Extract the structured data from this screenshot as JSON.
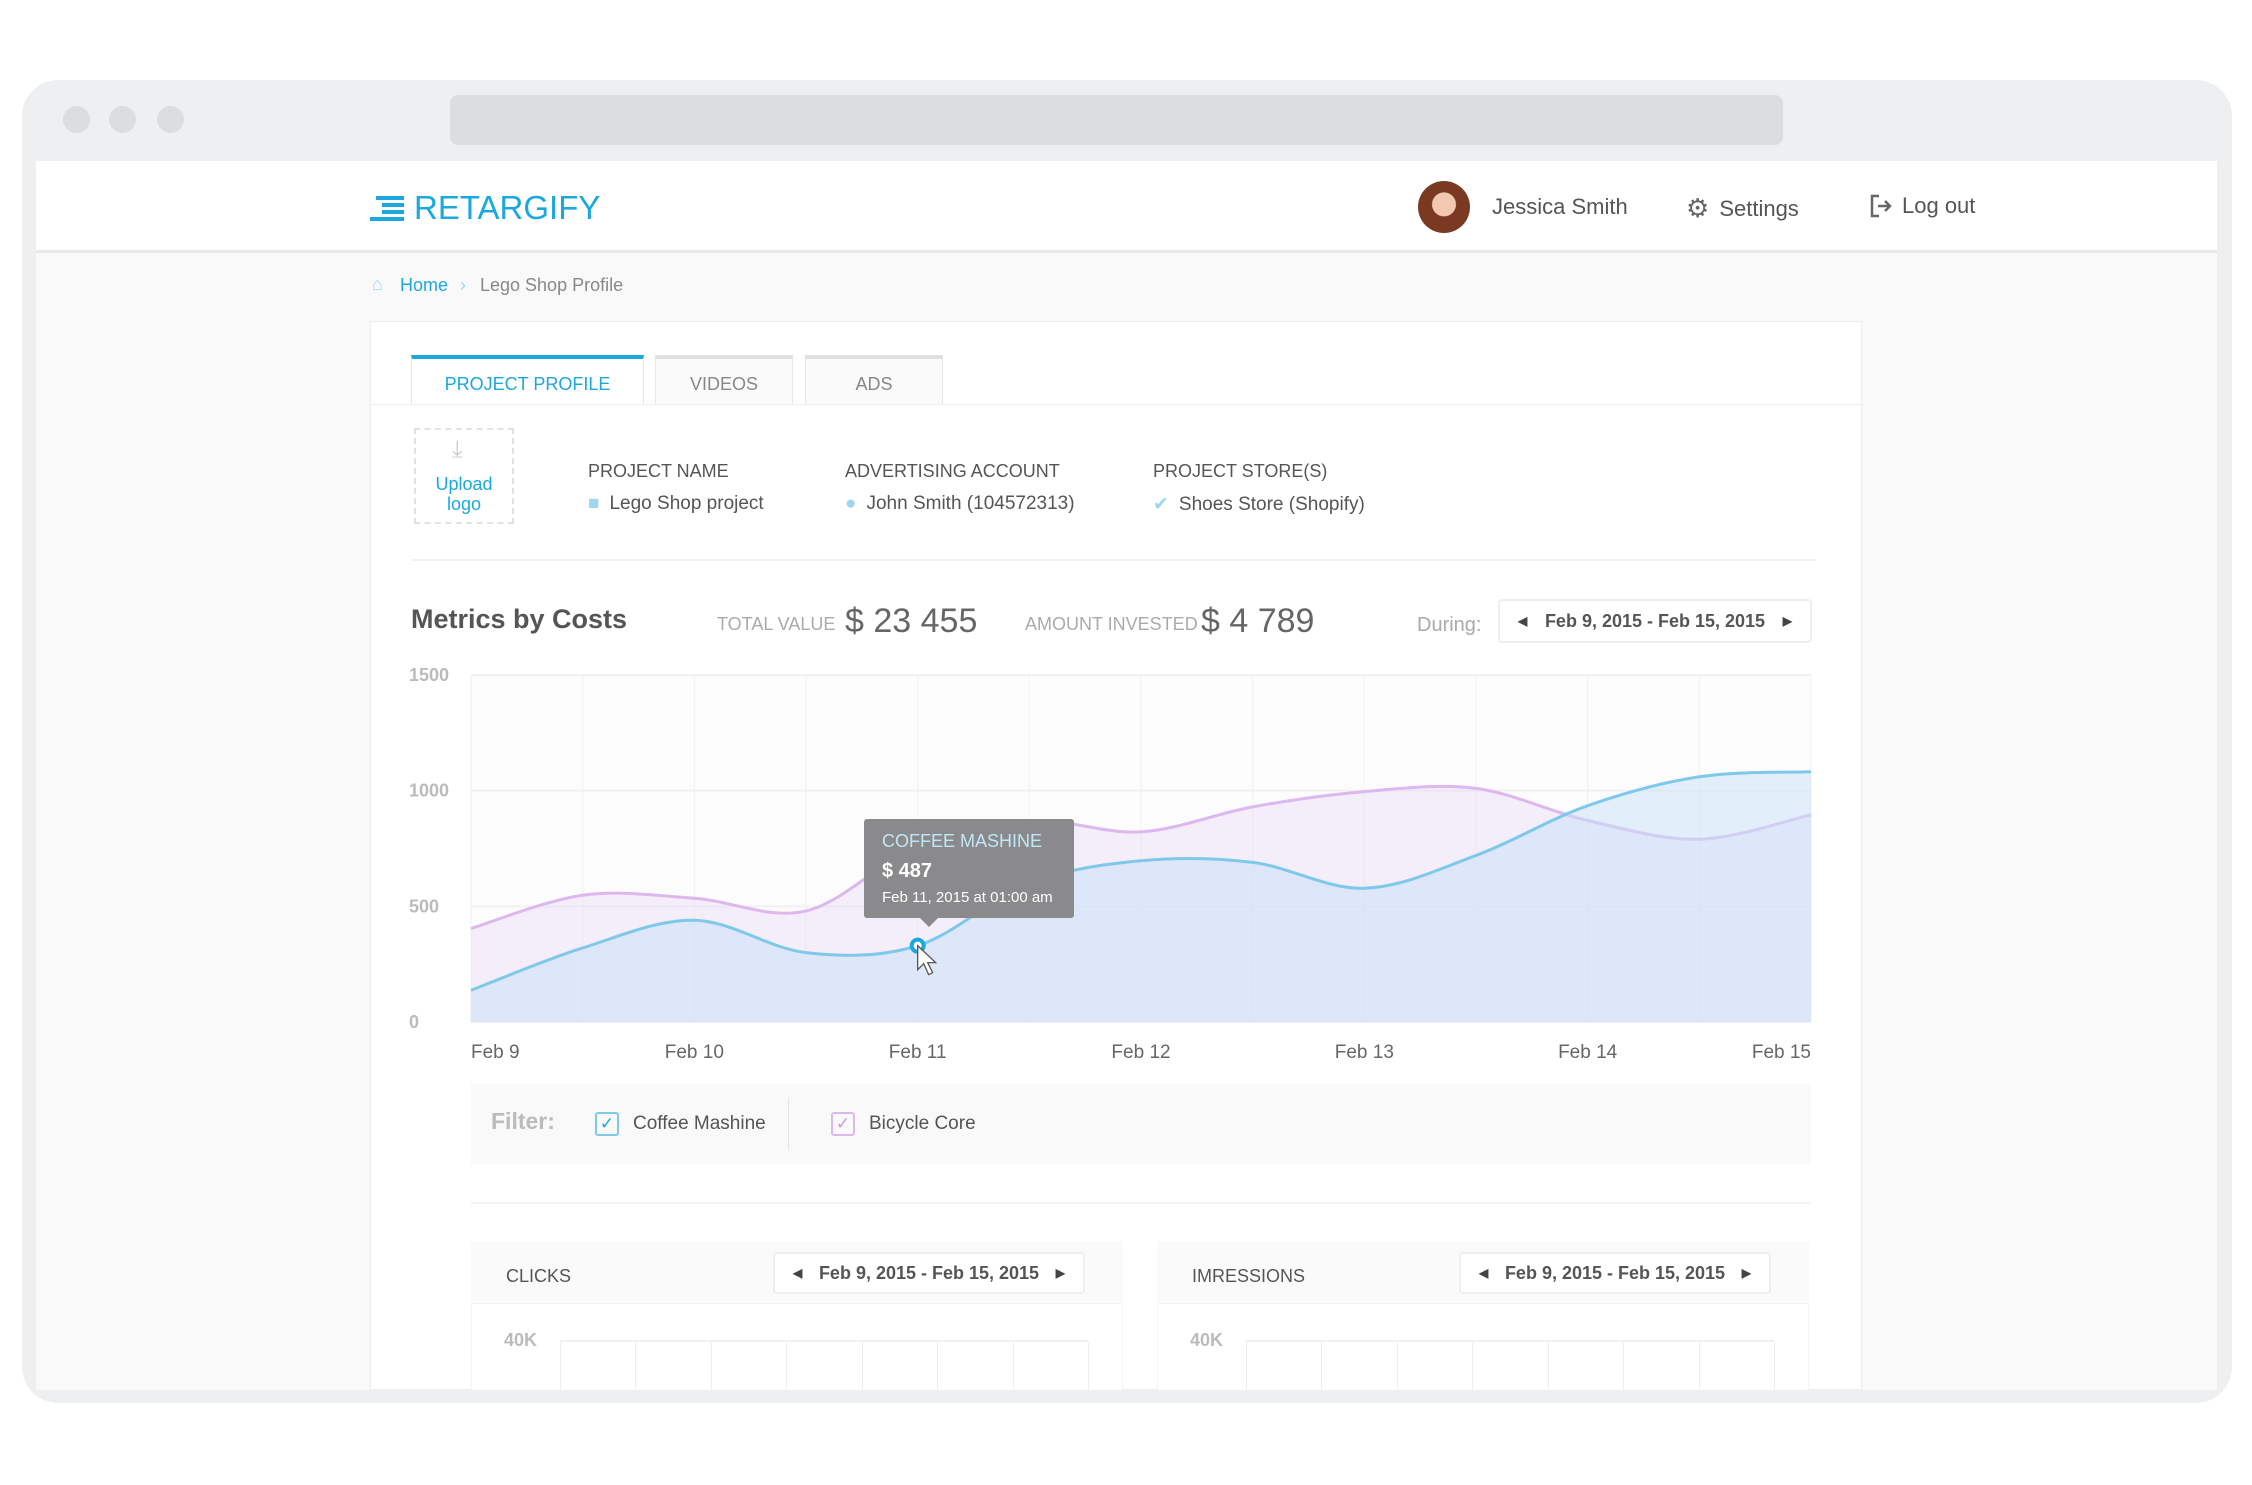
{
  "app": {
    "name": "RETARGIFY"
  },
  "header": {
    "user_name": "Jessica Smith",
    "settings_label": "Settings",
    "logout_label": "Log out"
  },
  "breadcrumb": {
    "home": "Home",
    "current": "Lego Shop Profile"
  },
  "tabs": [
    {
      "label": "PROJECT PROFILE",
      "active": true
    },
    {
      "label": "VIDEOS"
    },
    {
      "label": "ADS"
    }
  ],
  "project": {
    "upload_label": "Upload logo",
    "name_label": "PROJECT NAME",
    "name_value": "Lego Shop project",
    "account_label": "ADVERTISING ACCOUNT",
    "account_value": "John Smith (104572313)",
    "stores_label": "PROJECT STORE(S)",
    "stores_value": "Shoes Store (Shopify)"
  },
  "metrics": {
    "title": "Metrics by Costs",
    "total_label": "TOTAL VALUE",
    "total_value": "$ 23 455",
    "invested_label": "AMOUNT INVESTED",
    "invested_value": "$ 4 789",
    "during_label": "During:",
    "date_range": "Feb 9, 2015 - Feb 15, 2015"
  },
  "tooltip": {
    "series": "COFFEE MASHINE",
    "value": "$ 487",
    "date": "Feb 11, 2015 at 01:00 am"
  },
  "filter": {
    "label": "Filter:",
    "items": [
      {
        "label": "Coffee Mashine",
        "checked": true
      },
      {
        "label": "Bicycle Core",
        "checked": true
      }
    ]
  },
  "colors": {
    "accent": "#1ba8dc",
    "coffee": "#7ec9ea",
    "bicycle": "#dcb8ef"
  },
  "chart_data": {
    "type": "area",
    "x_ticks": [
      "Feb 9",
      "Feb 10",
      "Feb 11",
      "Feb 12",
      "Feb 13",
      "Feb 14",
      "Feb 15"
    ],
    "y_ticks": [
      "0",
      "500",
      "1000",
      "1500"
    ],
    "ylim": [
      0,
      1500
    ],
    "grid": true,
    "x": [
      9,
      9.5,
      10,
      10.5,
      11,
      11.5,
      12,
      12.5,
      13,
      13.5,
      14,
      14.5,
      15
    ],
    "series": [
      {
        "name": "Coffee Mashine",
        "color": "#7ec9ea",
        "values": [
          137,
          320,
          440,
          300,
          330,
          600,
          697,
          690,
          578,
          720,
          935,
          1060,
          1082
        ]
      },
      {
        "name": "Bicycle Core",
        "color": "#dcb8ef",
        "values": [
          404,
          548,
          535,
          480,
          760,
          870,
          822,
          930,
          996,
          1010,
          871,
          790,
          896
        ]
      }
    ]
  },
  "clicks": {
    "title": "CLICKS",
    "date_range": "Feb 9, 2015 - Feb 15, 2015",
    "y_tick": "40K"
  },
  "impressions": {
    "title": "IMRESSIONS",
    "date_range": "Feb 9, 2015 - Feb 15, 2015",
    "y_tick": "40K"
  }
}
